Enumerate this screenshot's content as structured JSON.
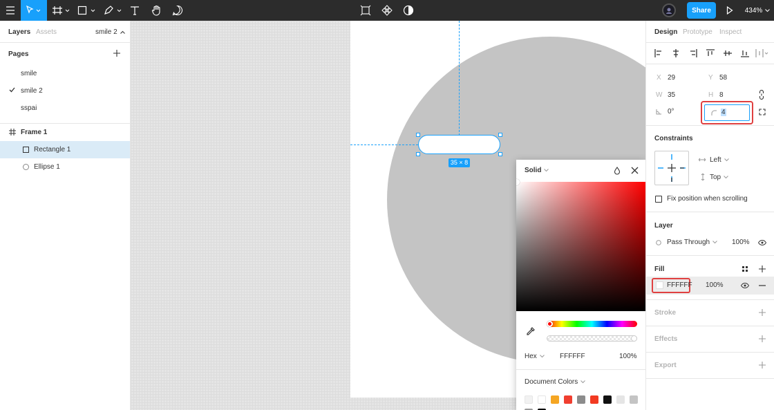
{
  "toolbar": {
    "share_label": "Share",
    "zoom_label": "434%"
  },
  "left_panel": {
    "tabs": {
      "layers": "Layers",
      "assets": "Assets"
    },
    "current_page": "smile 2",
    "pages_title": "Pages",
    "pages": [
      {
        "label": "smile",
        "checked": false
      },
      {
        "label": "smile 2",
        "checked": true
      },
      {
        "label": "sspai",
        "checked": false
      }
    ],
    "layers": [
      {
        "label": "Frame 1",
        "type": "frame"
      },
      {
        "label": "Rectangle 1",
        "type": "rectangle",
        "selected": true
      },
      {
        "label": "Ellipse 1",
        "type": "ellipse"
      }
    ]
  },
  "canvas": {
    "size_label": "35 × 8"
  },
  "color_picker": {
    "paint_type": "Solid",
    "color_model": "Hex",
    "hex": "FFFFFF",
    "opacity": "100%",
    "document_colors_label": "Document Colors",
    "swatches": [
      "#F2F2F2",
      "#FFFFFF",
      "#F5A623",
      "#F03E2F",
      "#8C8C8C",
      "#F23A22",
      "#111111",
      "#E5E5E5",
      "#C4C4C4",
      "#999999",
      "#000000"
    ]
  },
  "right_panel": {
    "tabs": {
      "design": "Design",
      "prototype": "Prototype",
      "inspect": "Inspect"
    },
    "x_label": "X",
    "x": "29",
    "y_label": "Y",
    "y": "58",
    "w_label": "W",
    "w": "35",
    "h_label": "H",
    "h": "8",
    "rotation": "0°",
    "radius": "4",
    "constraints_title": "Constraints",
    "h_constraint": "Left",
    "v_constraint": "Top",
    "fix_position_label": "Fix position when scrolling",
    "layer_title": "Layer",
    "blend_mode": "Pass Through",
    "layer_opacity": "100%",
    "fill_title": "Fill",
    "fill_hex": "FFFFFF",
    "fill_opacity": "100%",
    "stroke_title": "Stroke",
    "effects_title": "Effects",
    "export_title": "Export"
  }
}
